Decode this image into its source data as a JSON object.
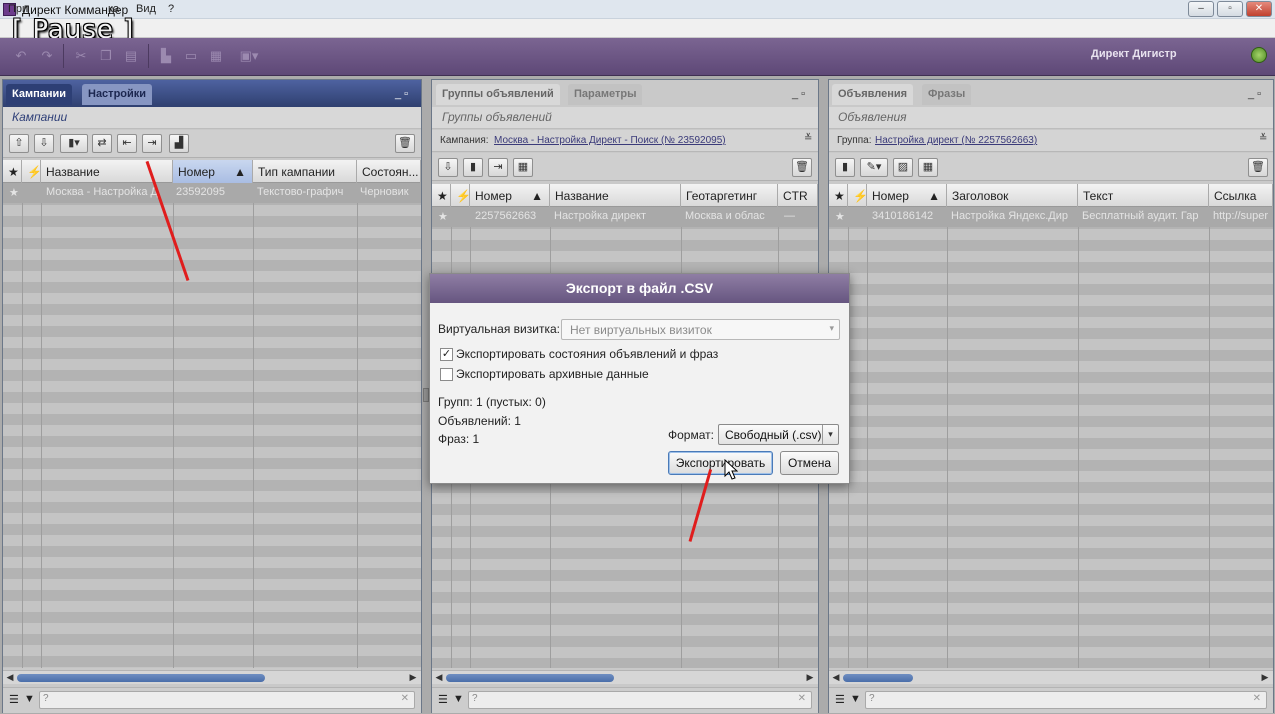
{
  "window": {
    "title": "Директ Коммандер",
    "min": "–",
    "max": "▫",
    "close": "✕"
  },
  "overlay": {
    "pause": "[ Pause ]"
  },
  "menu": {
    "item1": "При",
    "item2": "ка",
    "item3": "Вид",
    "item4": "?"
  },
  "toolbar": {
    "brand": "Директ Дигистр"
  },
  "left": {
    "tabs": [
      "Кампании",
      "Настройки"
    ],
    "subtitle": "Кампании",
    "columns": [
      "Название",
      "Номер",
      "Тип кампании",
      "Состоян..."
    ],
    "row": {
      "name": "Москва - Настройка Д",
      "number": "23592095",
      "type": "Текстово-графич",
      "state": "Черновик"
    }
  },
  "middle": {
    "tabs": [
      "Группы объявлений",
      "Параметры"
    ],
    "subtitle": "Группы объявлений",
    "crumb_label": "Кампания:",
    "crumb_link": "Москва - Настройка Директ - Поиск (№ 23592095)",
    "columns": [
      "Номер",
      "Название",
      "Геотаргетинг",
      "CTR"
    ],
    "row": {
      "number": "2257562663",
      "name": "Настройка директ",
      "geo": "Москва и облас",
      "ctr": "—"
    }
  },
  "right": {
    "tabs": [
      "Объявления",
      "Фразы"
    ],
    "subtitle": "Объявления",
    "crumb_label": "Группа:",
    "crumb_link": "Настройка директ (№ 2257562663)",
    "columns": [
      "Номер",
      "Заголовок",
      "Текст",
      "Ссылка"
    ],
    "row": {
      "number": "3410186142",
      "title": "Настройка Яндекс.Дир",
      "text": "Бесплатный аудит. Гар",
      "link": "http://super"
    }
  },
  "dialog": {
    "title": "Экспорт в файл .CSV",
    "vcard_label": "Виртуальная визитка:",
    "vcard_value": "Нет виртуальных визиток",
    "export_states_label": "Экспортировать состояния объявлений и фраз",
    "export_states_checked": true,
    "export_archive_label": "Экспортировать архивные данные",
    "export_archive_checked": false,
    "groups": "Групп: 1 (пустых: 0)",
    "ads": "Объявлений: 1",
    "phrases": "Фраз: 1",
    "format_label": "Формат:",
    "format_value": "Свободный (.csv)",
    "export_button": "Экспортировать",
    "cancel_button": "Отмена"
  },
  "colors": {
    "accent": "#3b4d81",
    "toolbar": "#6e5886",
    "annotation": "#e01d1d"
  }
}
